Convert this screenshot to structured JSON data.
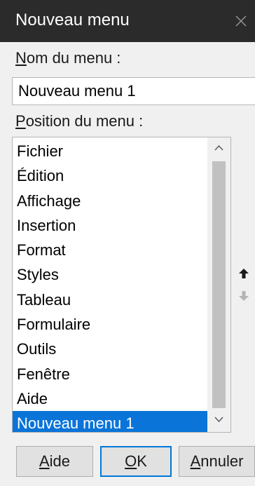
{
  "window": {
    "title": "Nouveau menu",
    "close_icon": "close-icon"
  },
  "name_field": {
    "label_first": "N",
    "label_rest": "om du menu :",
    "value": "Nouveau menu 1"
  },
  "position": {
    "label_first": "P",
    "label_rest": "osition du menu :",
    "items": [
      "Fichier",
      "Édition",
      "Affichage",
      "Insertion",
      "Format",
      "Styles",
      "Tableau",
      "Formulaire",
      "Outils",
      "Fenêtre",
      "Aide",
      "Nouveau menu 1"
    ],
    "selected_item": "Nouveau menu 1",
    "move_up_icon": "arrow-up-icon",
    "move_down_icon": "arrow-down-icon"
  },
  "buttons": {
    "help_first": "A",
    "help_rest": "ide",
    "ok_first": "O",
    "ok_rest": "K",
    "cancel_first": "A",
    "cancel_rest": "nnuler"
  },
  "colors": {
    "titlebar": "#2b2b2b",
    "selection": "#0a74d8",
    "default_button_border": "#0078d7"
  }
}
